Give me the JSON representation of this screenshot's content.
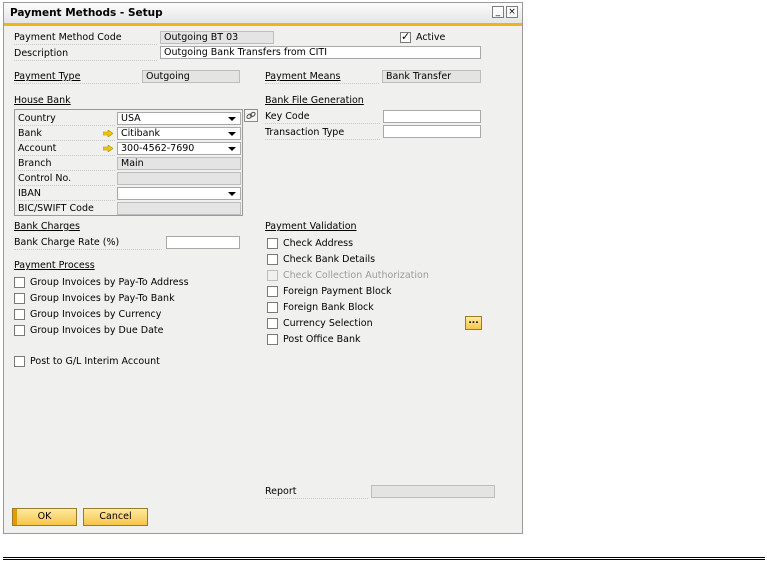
{
  "window": {
    "title": "Payment Methods - Setup",
    "minimize_glyph": "_",
    "close_glyph": "×"
  },
  "header": {
    "code_label": "Payment Method Code",
    "code_value": "Outgoing BT 03",
    "active_label": "Active",
    "active_checked": true,
    "description_label": "Description",
    "description_value": "Outgoing Bank Transfers from CITI",
    "payment_type_label": "Payment Type",
    "payment_type_value": "Outgoing",
    "payment_means_label": "Payment Means",
    "payment_means_value": "Bank Transfer"
  },
  "house_bank": {
    "section_label": "House Bank",
    "country_label": "Country",
    "country_value": "USA",
    "bank_label": "Bank",
    "bank_value": "Citibank",
    "account_label": "Account",
    "account_value": "300-4562-7690",
    "branch_label": "Branch",
    "branch_value": "Main",
    "control_label": "Control No.",
    "control_value": "",
    "iban_label": "IBAN",
    "iban_value": "",
    "bic_label": "BIC/SWIFT Code",
    "bic_value": ""
  },
  "bank_file": {
    "section_label": "Bank File Generation",
    "key_code_label": "Key Code",
    "key_code_value": "",
    "transaction_type_label": "Transaction Type",
    "transaction_type_value": ""
  },
  "bank_charges": {
    "section_label": "Bank Charges",
    "rate_label": "Bank Charge Rate (%)",
    "rate_value": ""
  },
  "payment_process": {
    "section_label": "Payment Process",
    "items": [
      {
        "label": "Group Invoices by Pay-To Address",
        "checked": false
      },
      {
        "label": "Group Invoices by Pay-To Bank",
        "checked": false
      },
      {
        "label": "Group Invoices by Currency",
        "checked": false
      },
      {
        "label": "Group Invoices by Due Date",
        "checked": false
      }
    ],
    "interim_label": "Post to G/L Interim Account"
  },
  "payment_validation": {
    "section_label": "Payment Validation",
    "items": [
      {
        "label": "Check Address",
        "checked": false
      },
      {
        "label": "Check Bank Details",
        "checked": false
      },
      {
        "label": "Check Collection Authorization",
        "checked": false,
        "disabled": true
      },
      {
        "label": "Foreign Payment Block",
        "checked": false
      },
      {
        "label": "Foreign Bank Block",
        "checked": false
      },
      {
        "label": "Currency Selection",
        "checked": false
      },
      {
        "label": "Post Office Bank",
        "checked": false
      }
    ],
    "ellipsis_label": "..."
  },
  "report": {
    "label": "Report",
    "value": ""
  },
  "footer": {
    "ok_label": "OK",
    "cancel_label": "Cancel"
  },
  "colors": {
    "accent": "#f0b21e",
    "button": "#f5c54a",
    "window_bg": "#f0f0ef",
    "readonly_field": "#e4e4e4"
  },
  "icons": [
    "link-icon",
    "arrow-right-icon",
    "chevron-down-icon",
    "checkmark-icon"
  ]
}
